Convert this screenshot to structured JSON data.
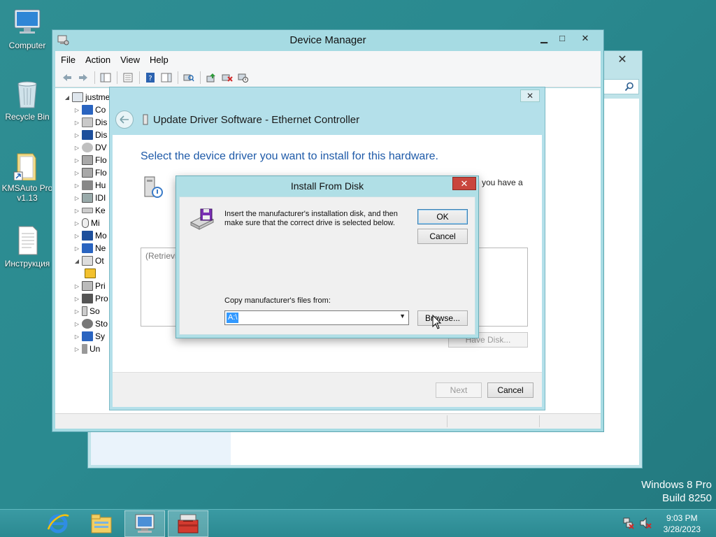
{
  "desktop": {
    "icons": [
      {
        "label": "Computer"
      },
      {
        "label": "Recycle Bin"
      },
      {
        "label": "KMSAuto Pro v1.13"
      },
      {
        "label": "Инструкция"
      }
    ],
    "watermark_line1": "Windows 8 Pro",
    "watermark_line2": "Build 8250"
  },
  "device_manager": {
    "title": "Device Manager",
    "menu": [
      "File",
      "Action",
      "View",
      "Help"
    ],
    "tree": {
      "root": "justme",
      "items": [
        "Co",
        "Dis",
        "Dis",
        "DV",
        "Flo",
        "Flo",
        "Hu",
        "IDI",
        "Ke",
        "Mi",
        "Mo",
        "Ne",
        "Ot",
        "",
        "Pri",
        "Pro",
        "So",
        "Sto",
        "Sy",
        "Un"
      ]
    }
  },
  "wizard": {
    "title": "Update Driver Software - Ethernet Controller",
    "heading": "Select the device driver you want to install for this hardware.",
    "partial_text": "you have a",
    "list_placeholder": "(Retrievi",
    "have_disk_label": "Have Disk...",
    "next_label": "Next",
    "cancel_label": "Cancel",
    "close_glyph": "✕"
  },
  "install_from_disk": {
    "title": "Install From Disk",
    "close_glyph": "✕",
    "message": "Insert the manufacturer's installation disk, and then make sure that the correct drive is selected below.",
    "ok_label": "OK",
    "cancel_label": "Cancel",
    "copy_label": "Copy manufacturer's files from:",
    "path_value": "A:\\",
    "browse_label": "Browse..."
  },
  "taskbar": {
    "time": "9:03 PM",
    "date": "3/28/2023"
  },
  "colors": {
    "desktop": "#2a8a90",
    "heading_blue": "#1e5aa8",
    "close_red": "#c9463d"
  }
}
